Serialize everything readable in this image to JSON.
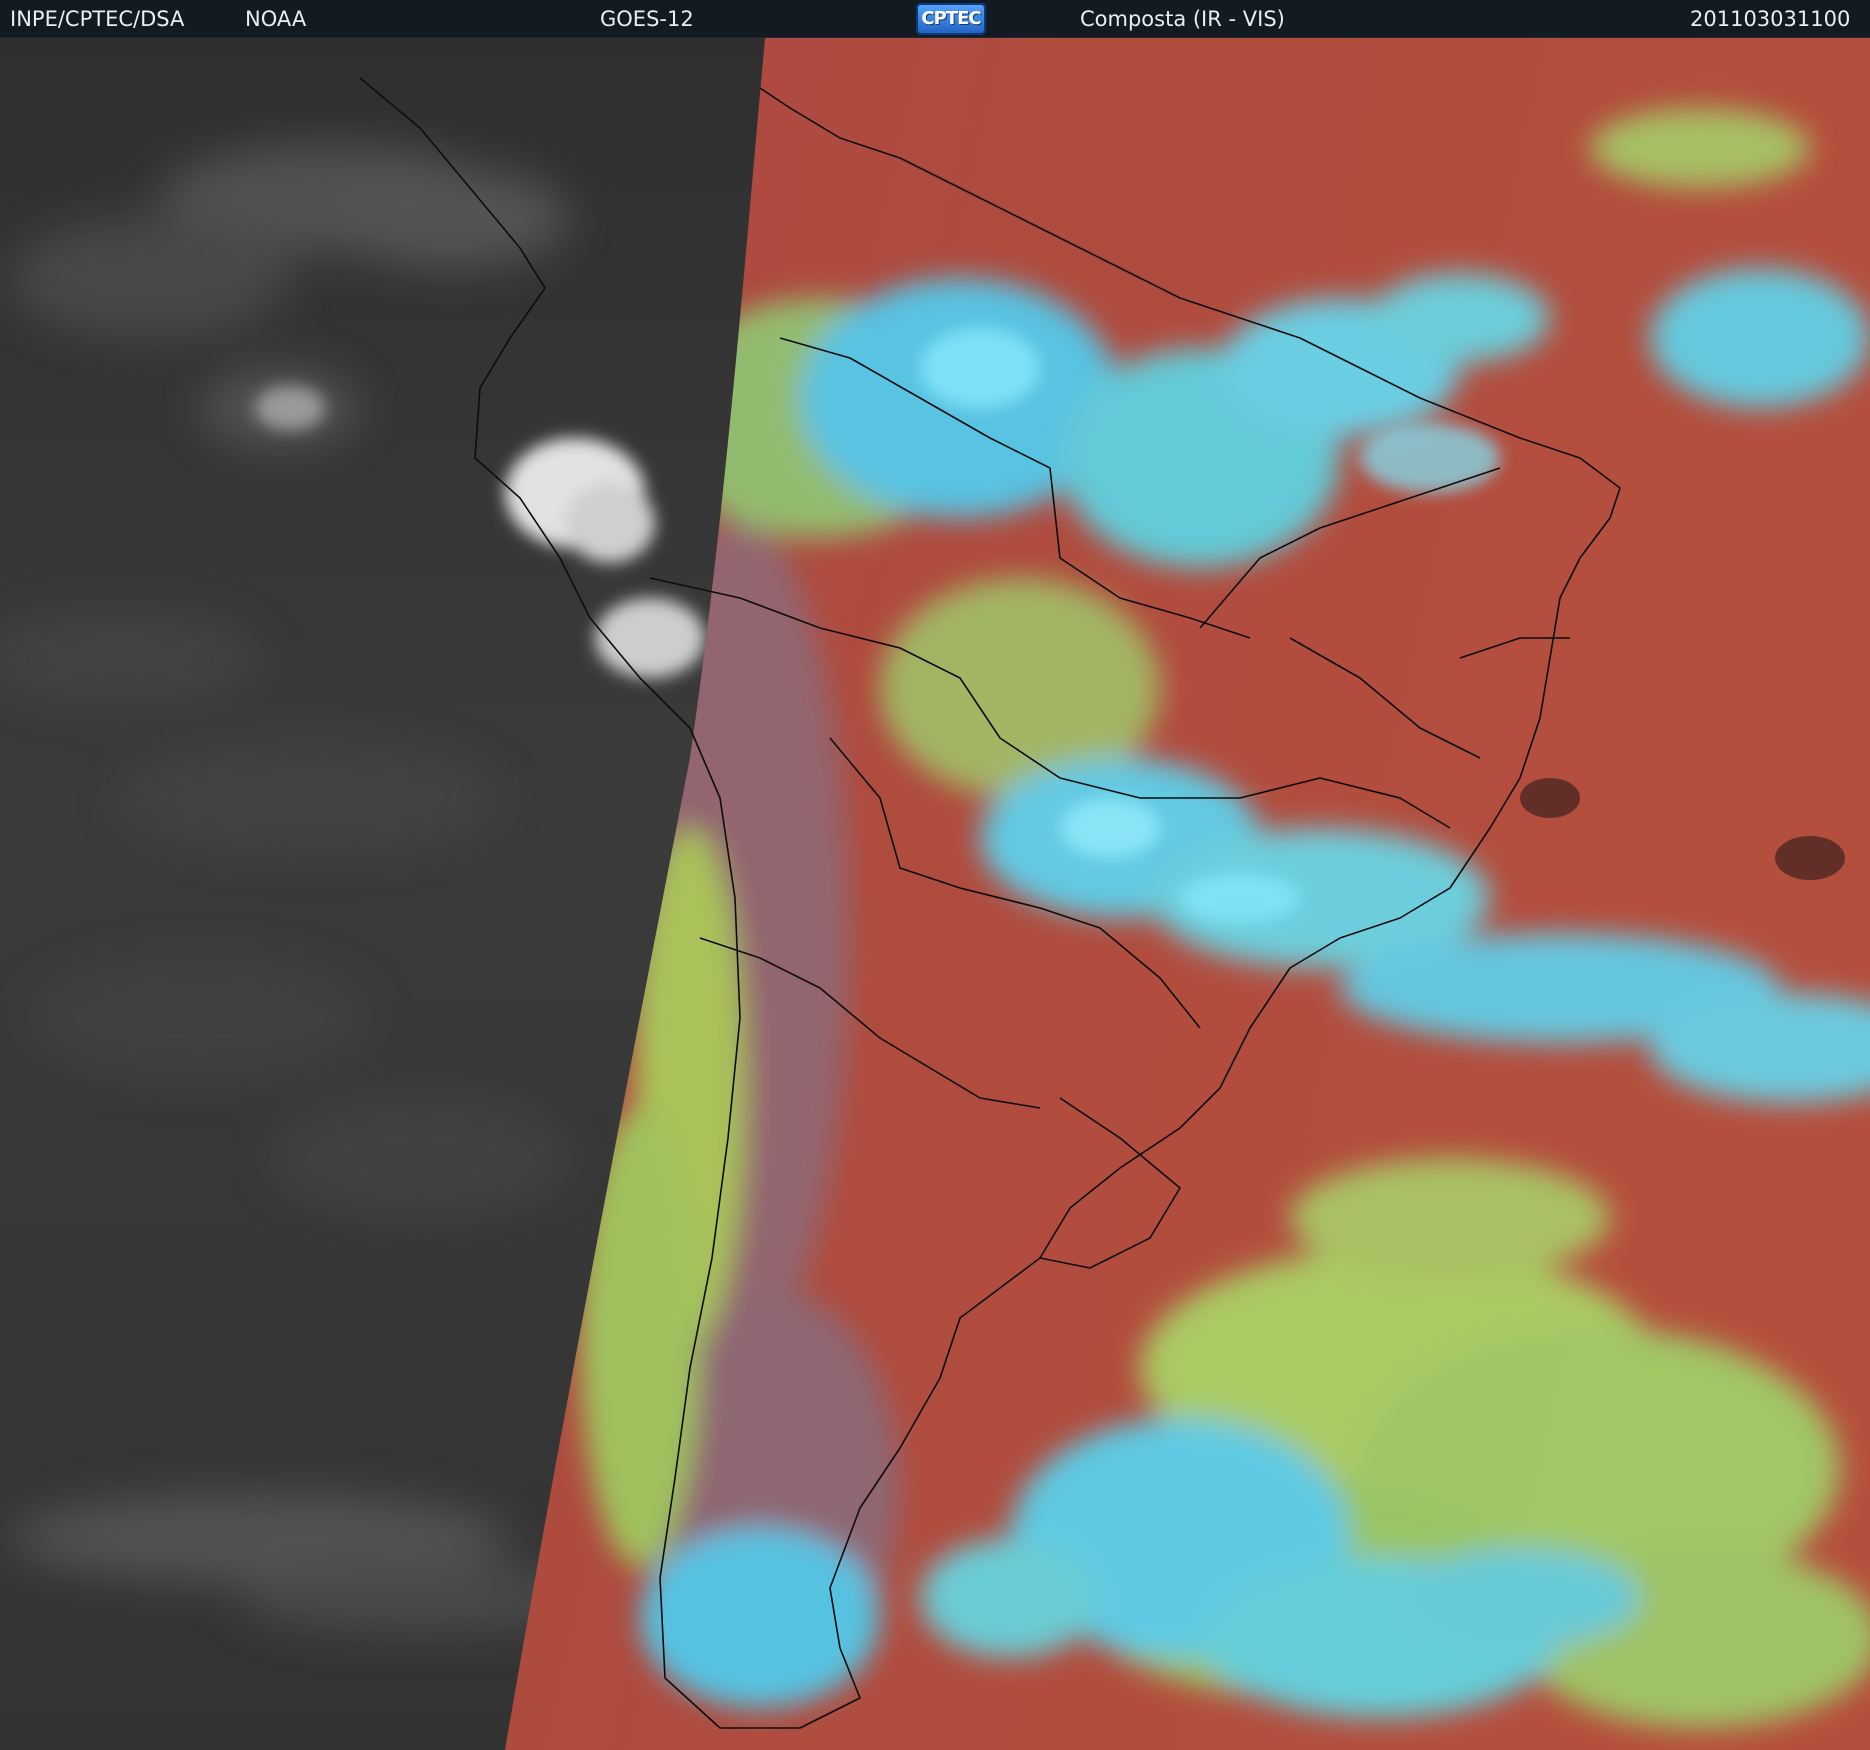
{
  "header": {
    "org": "INPE/CPTEC/DSA",
    "agency": "NOAA",
    "satellite": "GOES-12",
    "logo_text": "CPTEC",
    "product": "Composta (IR - VIS)",
    "timestamp": "201103031100"
  },
  "colors": {
    "header_bg": "#121a22",
    "ir_gray": "#3c3c3c",
    "surface_red": "#b4463c",
    "cloud_cyan": "#46e6ff",
    "cloud_green": "#9be66e"
  }
}
